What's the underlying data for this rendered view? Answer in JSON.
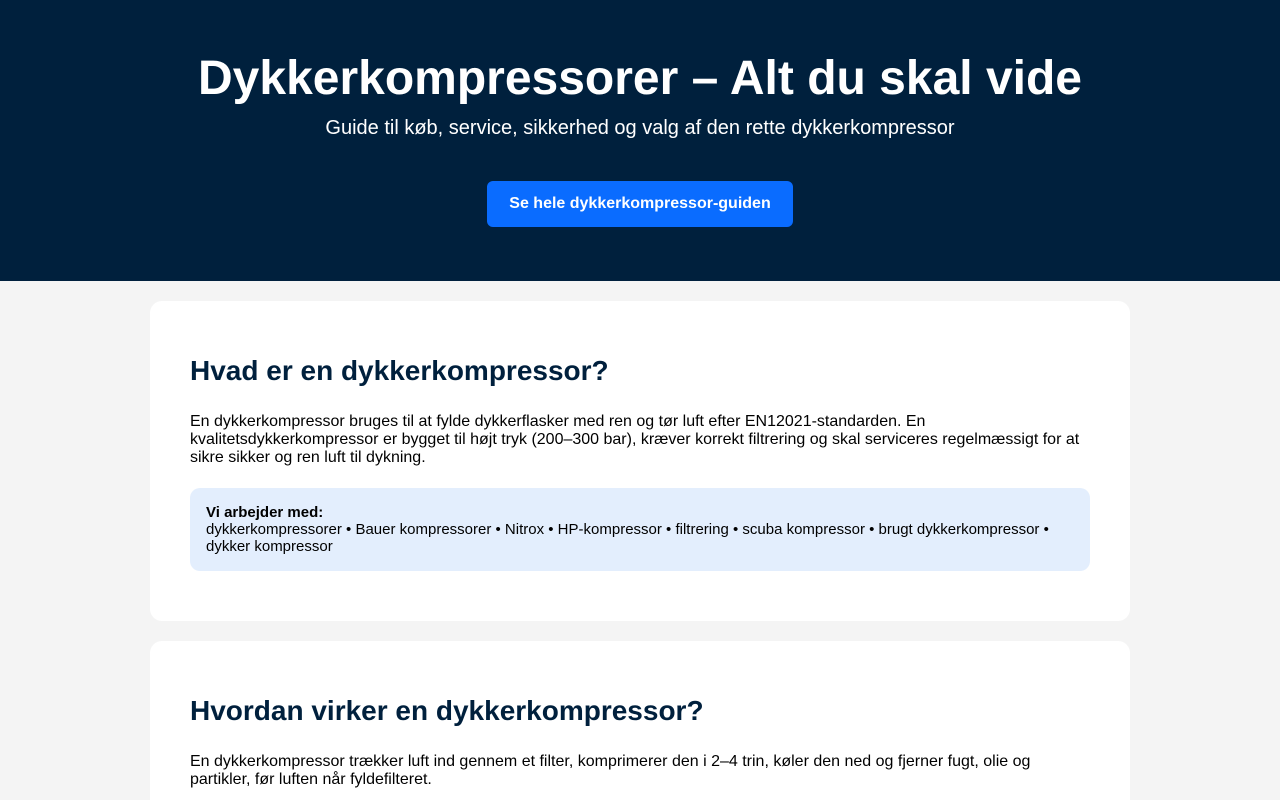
{
  "hero": {
    "title": "Dykkerkompressorer – Alt du skal vide",
    "subtitle": "Guide til køb, service, sikkerhed og valg af den rette dykkerkompressor",
    "cta_label": "Se hele dykkerkompressor-guiden"
  },
  "sections": [
    {
      "heading": "Hvad er en dykkerkompressor?",
      "body": "En dykkerkompressor bruges til at fylde dykkerflasker med ren og tør luft efter EN12021-standarden. En kvalitetsdykkerkompressor er bygget til højt tryk (200–300 bar), kræver korrekt filtrering og skal serviceres regelmæssigt for at sikre sikker og ren luft til dykning.",
      "tags_heading": "Vi arbejder med:",
      "tags_text": "dykkerkompressorer • Bauer kompressorer • Nitrox • HP-kompressor • filtrering • scuba kompressor • brugt dykkerkompressor • dykker kompressor"
    },
    {
      "heading": "Hvordan virker en dykkerkompressor?",
      "body": "En dykkerkompressor trækker luft ind gennem et filter, komprimerer den i 2–4 trin, køler den ned og fjerner fugt, olie og partikler, før luften når fyldefilteret."
    }
  ],
  "colors": {
    "hero_bg": "#00203d",
    "accent": "#0a6cff",
    "tag_bg": "#e3eefd",
    "page_bg": "#f4f4f4"
  }
}
